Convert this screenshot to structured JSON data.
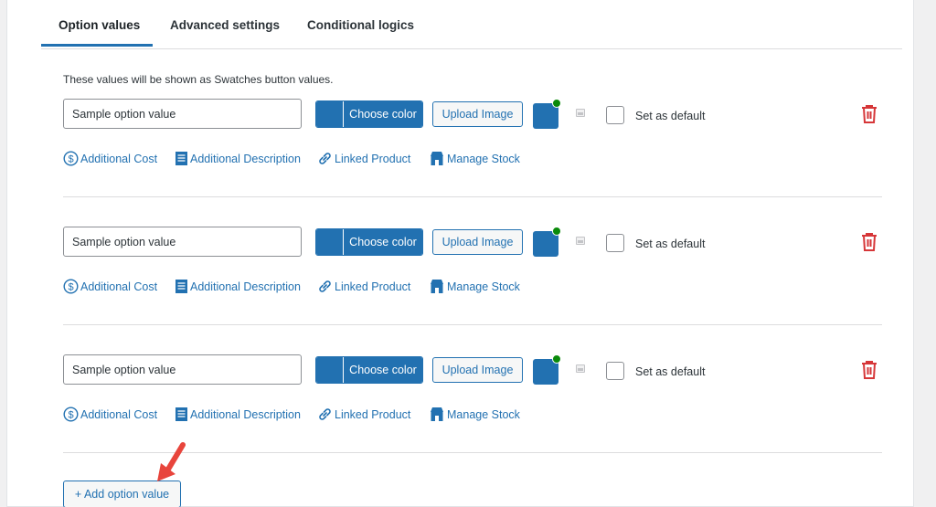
{
  "tabs": [
    {
      "label": "Option values",
      "active": true
    },
    {
      "label": "Advanced settings",
      "active": false
    },
    {
      "label": "Conditional logics",
      "active": false
    }
  ],
  "intro_text": "These values will be shown as Swatches button values.",
  "option_rows": [
    {
      "value": "Sample option value",
      "choose_color_label": "Choose color",
      "upload_image_label": "Upload Image",
      "default_label": "Set as default",
      "links": {
        "additional_cost": "Additional Cost",
        "additional_description": "Additional Description",
        "linked_product": "Linked Product",
        "manage_stock": "Manage Stock"
      }
    },
    {
      "value": "Sample option value",
      "choose_color_label": "Choose color",
      "upload_image_label": "Upload Image",
      "default_label": "Set as default",
      "links": {
        "additional_cost": "Additional Cost",
        "additional_description": "Additional Description",
        "linked_product": "Linked Product",
        "manage_stock": "Manage Stock"
      }
    },
    {
      "value": "Sample option value",
      "choose_color_label": "Choose color",
      "upload_image_label": "Upload Image",
      "default_label": "Set as default",
      "links": {
        "additional_cost": "Additional Cost",
        "additional_description": "Additional Description",
        "linked_product": "Linked Product",
        "manage_stock": "Manage Stock"
      }
    }
  ],
  "add_button_label": "+ Add option value",
  "colors": {
    "accent": "#2271b1",
    "delete": "#d63638",
    "status_dot": "#0a8a0a",
    "annotation_arrow": "#e8453c"
  },
  "icons": [
    "dollar-circle-icon",
    "document-icon",
    "link-icon",
    "store-icon",
    "trash-icon",
    "image-placeholder-icon",
    "annotation-arrow"
  ]
}
